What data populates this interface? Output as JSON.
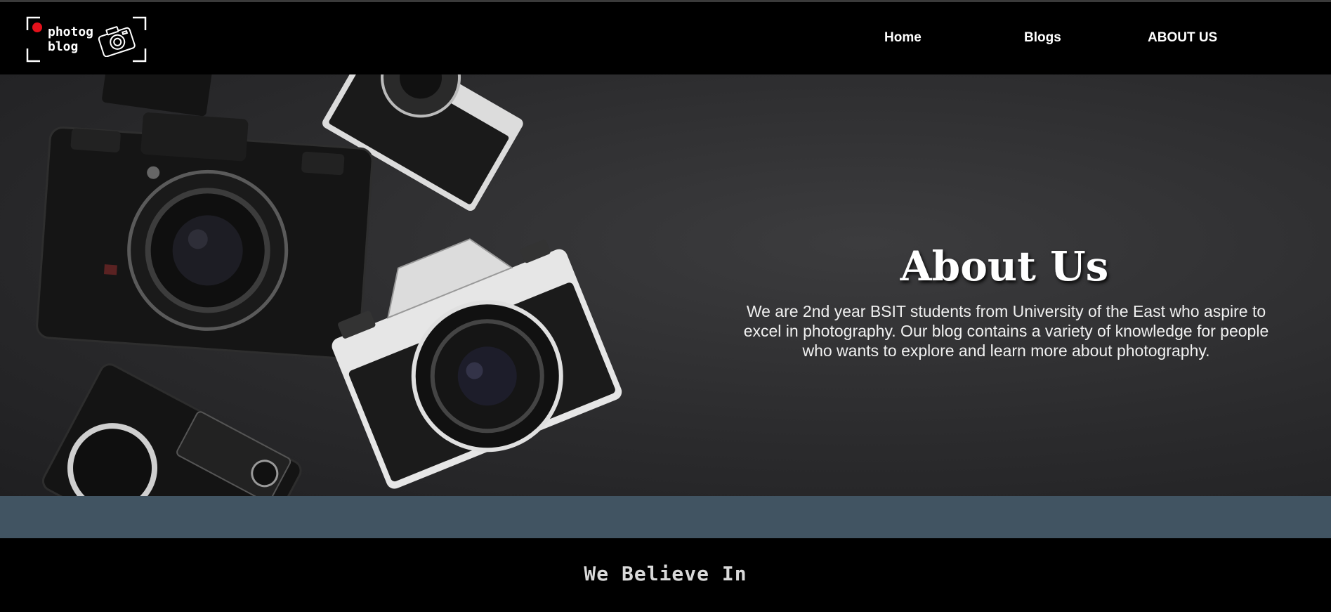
{
  "brand": {
    "line1": "photog",
    "line2": "blog",
    "dot_color": "#e4111b",
    "icon": "camera-icon"
  },
  "nav": {
    "items": [
      {
        "label": "Home"
      },
      {
        "label": "Blogs"
      },
      {
        "label": "ABOUT US"
      }
    ]
  },
  "hero": {
    "title": "About Us",
    "text": "We are 2nd year BSIT students from University of the East who aspire to excel in photography. Our blog contains a variety of knowledge for people who wants to explore and learn more about photography."
  },
  "band_color": "#415462",
  "section": {
    "title": "We Believe In"
  }
}
